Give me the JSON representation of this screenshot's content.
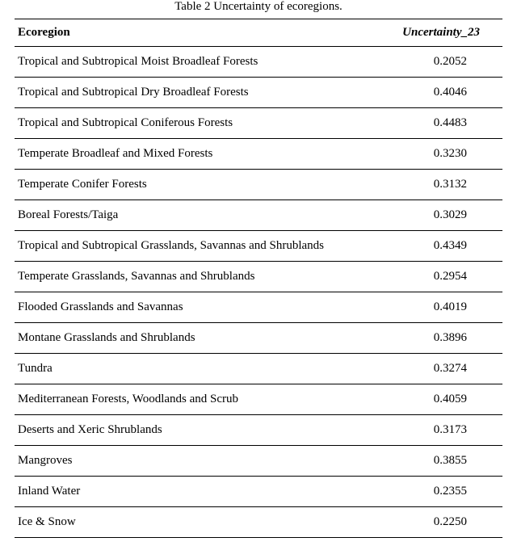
{
  "caption": "Table 2 Uncertainty of ecoregions.",
  "headers": {
    "ecoregion": "Ecoregion",
    "uncertainty": "Uncertainty_23"
  },
  "rows": [
    {
      "name": "Tropical and Subtropical Moist Broadleaf Forests",
      "value": "0.2052"
    },
    {
      "name": "Tropical and Subtropical Dry Broadleaf Forests",
      "value": "0.4046"
    },
    {
      "name": "Tropical and Subtropical Coniferous Forests",
      "value": "0.4483"
    },
    {
      "name": "Temperate Broadleaf and Mixed Forests",
      "value": "0.3230"
    },
    {
      "name": "Temperate Conifer Forests",
      "value": "0.3132"
    },
    {
      "name": "Boreal Forests/Taiga",
      "value": "0.3029"
    },
    {
      "name": "Tropical and Subtropical Grasslands, Savannas and Shrublands",
      "value": "0.4349"
    },
    {
      "name": "Temperate Grasslands, Savannas and Shrublands",
      "value": "0.2954"
    },
    {
      "name": "Flooded Grasslands and Savannas",
      "value": "0.4019"
    },
    {
      "name": "Montane Grasslands and Shrublands",
      "value": "0.3896"
    },
    {
      "name": "Tundra",
      "value": "0.3274"
    },
    {
      "name": "Mediterranean Forests, Woodlands and Scrub",
      "value": "0.4059"
    },
    {
      "name": "Deserts and Xeric Shrublands",
      "value": "0.3173"
    },
    {
      "name": "Mangroves",
      "value": "0.3855"
    },
    {
      "name": "Inland Water",
      "value": "0.2355"
    },
    {
      "name": "Ice & Snow",
      "value": "0.2250"
    }
  ],
  "chart_data": {
    "type": "table",
    "title": "Table 2 Uncertainty of ecoregions.",
    "columns": [
      "Ecoregion",
      "Uncertainty_23"
    ],
    "rows": [
      [
        "Tropical and Subtropical Moist Broadleaf Forests",
        0.2052
      ],
      [
        "Tropical and Subtropical Dry Broadleaf Forests",
        0.4046
      ],
      [
        "Tropical and Subtropical Coniferous Forests",
        0.4483
      ],
      [
        "Temperate Broadleaf and Mixed Forests",
        0.323
      ],
      [
        "Temperate Conifer Forests",
        0.3132
      ],
      [
        "Boreal Forests/Taiga",
        0.3029
      ],
      [
        "Tropical and Subtropical Grasslands, Savannas and Shrublands",
        0.4349
      ],
      [
        "Temperate Grasslands, Savannas and Shrublands",
        0.2954
      ],
      [
        "Flooded Grasslands and Savannas",
        0.4019
      ],
      [
        "Montane Grasslands and Shrublands",
        0.3896
      ],
      [
        "Tundra",
        0.3274
      ],
      [
        "Mediterranean Forests, Woodlands and Scrub",
        0.4059
      ],
      [
        "Deserts and Xeric Shrublands",
        0.3173
      ],
      [
        "Mangroves",
        0.3855
      ],
      [
        "Inland Water",
        0.2355
      ],
      [
        "Ice & Snow",
        0.225
      ]
    ]
  }
}
